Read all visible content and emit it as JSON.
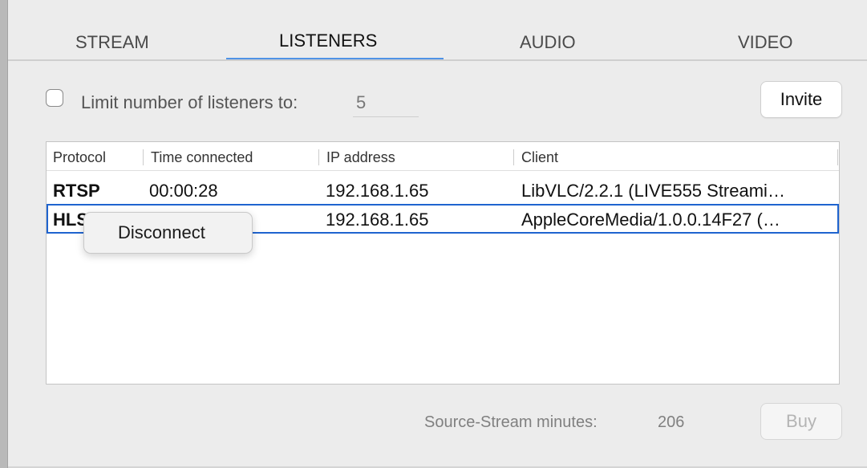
{
  "tabs": [
    {
      "label": "STREAM",
      "active": false
    },
    {
      "label": "LISTENERS",
      "active": true
    },
    {
      "label": "AUDIO",
      "active": false
    },
    {
      "label": "VIDEO",
      "active": false
    }
  ],
  "limit": {
    "label": "Limit number of listeners to:",
    "value": "5",
    "checked": false
  },
  "invite_label": "Invite",
  "table": {
    "columns": [
      "Protocol",
      "Time connected",
      "IP address",
      "Client"
    ],
    "rows": [
      {
        "protocol": "RTSP",
        "time": "00:00:28",
        "ip": "192.168.1.65",
        "client": "LibVLC/2.2.1 (LIVE555 Streami…"
      },
      {
        "protocol": "HLS",
        "time": "",
        "ip": "192.168.1.65",
        "client": "AppleCoreMedia/1.0.0.14F27 (…"
      }
    ],
    "selected_row": 1
  },
  "context_menu": {
    "items": [
      "Disconnect"
    ]
  },
  "footer": {
    "minutes_label": "Source-Stream minutes:",
    "minutes_value": "206",
    "buy_label": "Buy"
  },
  "colors": {
    "accent": "#4f93e6",
    "selection_outline": "#1f64cf",
    "background": "#ececec"
  }
}
